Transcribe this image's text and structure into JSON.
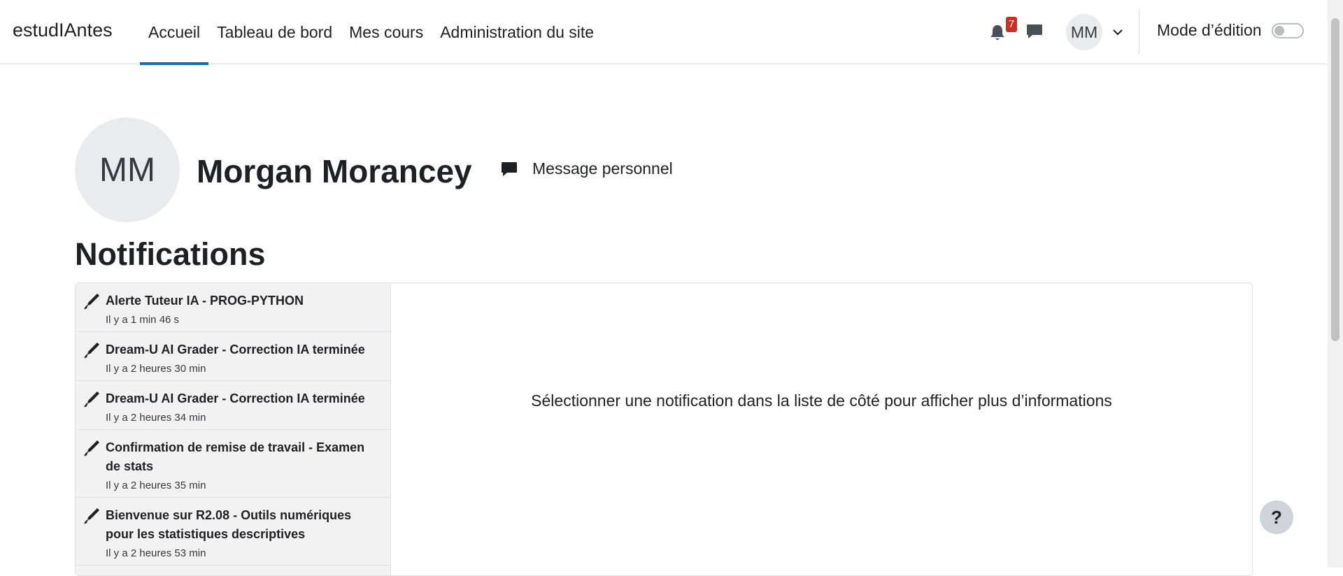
{
  "brand": "estudIAntes",
  "nav": {
    "items": [
      {
        "label": "Accueil"
      },
      {
        "label": "Tableau de bord"
      },
      {
        "label": "Mes cours"
      },
      {
        "label": "Administration du site"
      }
    ],
    "notification_count": "7",
    "user_initials": "MM",
    "edit_mode_label": "Mode d’édition"
  },
  "profile": {
    "initials": "MM",
    "name": "Morgan Morancey",
    "message_label": "Message personnel"
  },
  "page_title": "Notifications",
  "notifications": [
    {
      "title": "Alerte Tuteur IA - PROG-PYTHON",
      "time": "Il y a 1 min 46 s"
    },
    {
      "title": "Dream-U AI Grader - Correction IA terminée",
      "time": "Il y a 2 heures 30 min"
    },
    {
      "title": "Dream-U AI Grader - Correction IA terminée",
      "time": "Il y a 2 heures 34 min"
    },
    {
      "title": "Confirmation de remise de travail - Examen de stats",
      "time": "Il y a 2 heures 35 min"
    },
    {
      "title": "Bienvenue sur R2.08 - Outils numériques pour les statistiques descriptives",
      "time": "Il y a 2 heures 53 min"
    }
  ],
  "detail_placeholder": "Sélectionner une notification dans la liste de côté pour afficher plus d’informations",
  "help_label": "?",
  "colors": {
    "accent": "#0f6cbf",
    "badge": "#ca3120"
  }
}
